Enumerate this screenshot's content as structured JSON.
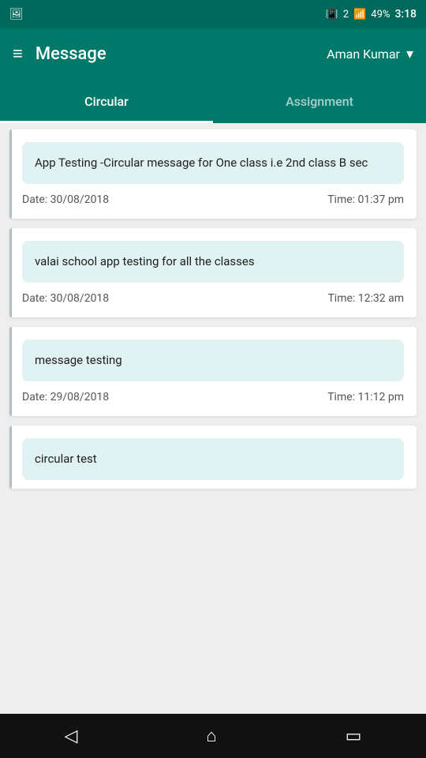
{
  "statusBar": {
    "batteryPercent": "49%",
    "time": "3:18",
    "simSlot": "2"
  },
  "header": {
    "title": "Message",
    "userName": "Aman Kumar",
    "menuIcon": "≡",
    "dropdownIcon": "▾"
  },
  "tabs": [
    {
      "id": "circular",
      "label": "Circular",
      "active": true
    },
    {
      "id": "assignment",
      "label": "Assignment",
      "active": false
    }
  ],
  "messages": [
    {
      "id": 1,
      "text": "App Testing -Circular message for One class i.e 2nd class B sec",
      "date": "Date: 30/08/2018",
      "time": "Time: 01:37 pm"
    },
    {
      "id": 2,
      "text": "valai school app testing for all the classes",
      "date": "Date: 30/08/2018",
      "time": "Time: 12:32 am"
    },
    {
      "id": 3,
      "text": "message testing",
      "date": "Date: 29/08/2018",
      "time": "Time: 11:12 pm"
    },
    {
      "id": 4,
      "text": "circular test",
      "date": "",
      "time": ""
    }
  ],
  "bottomNav": {
    "backIcon": "◁",
    "homeIcon": "⌂",
    "recentIcon": "▭"
  }
}
